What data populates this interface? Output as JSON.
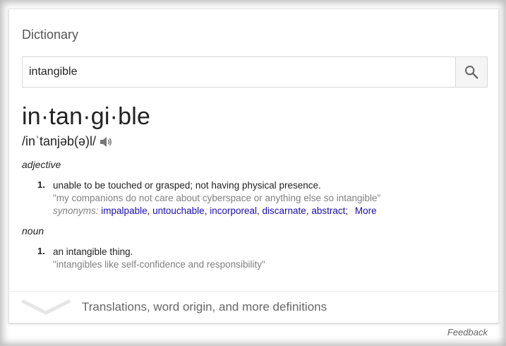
{
  "card": {
    "title": "Dictionary"
  },
  "search": {
    "value": "intangible"
  },
  "entry": {
    "headword": "in·tan·gi·ble",
    "pronunciation": "/inˈtanjəb(ə)l/"
  },
  "senses": [
    {
      "part_of_speech": "adjective",
      "number": "1.",
      "definition": "unable to be touched or grasped; not having physical presence.",
      "example": "\"my companions do not care about cyberspace or anything else so intangible\"",
      "synonyms_label": "synonyms:",
      "synonyms": [
        "impalpable",
        "untouchable",
        "incorporeal",
        "discarnate",
        "abstract"
      ],
      "more_label": "More"
    },
    {
      "part_of_speech": "noun",
      "number": "1.",
      "definition": "an intangible thing.",
      "example": "\"intangibles like self-confidence and responsibility\""
    }
  ],
  "footer": {
    "label": "Translations, word origin, and more definitions"
  },
  "feedback": {
    "label": "Feedback"
  },
  "colors": {
    "link": "#1a0dab",
    "muted": "#808080",
    "text": "#222222"
  },
  "icons": {
    "search": "search-icon",
    "speaker": "speaker-icon",
    "expand": "chevron-down-icon"
  }
}
